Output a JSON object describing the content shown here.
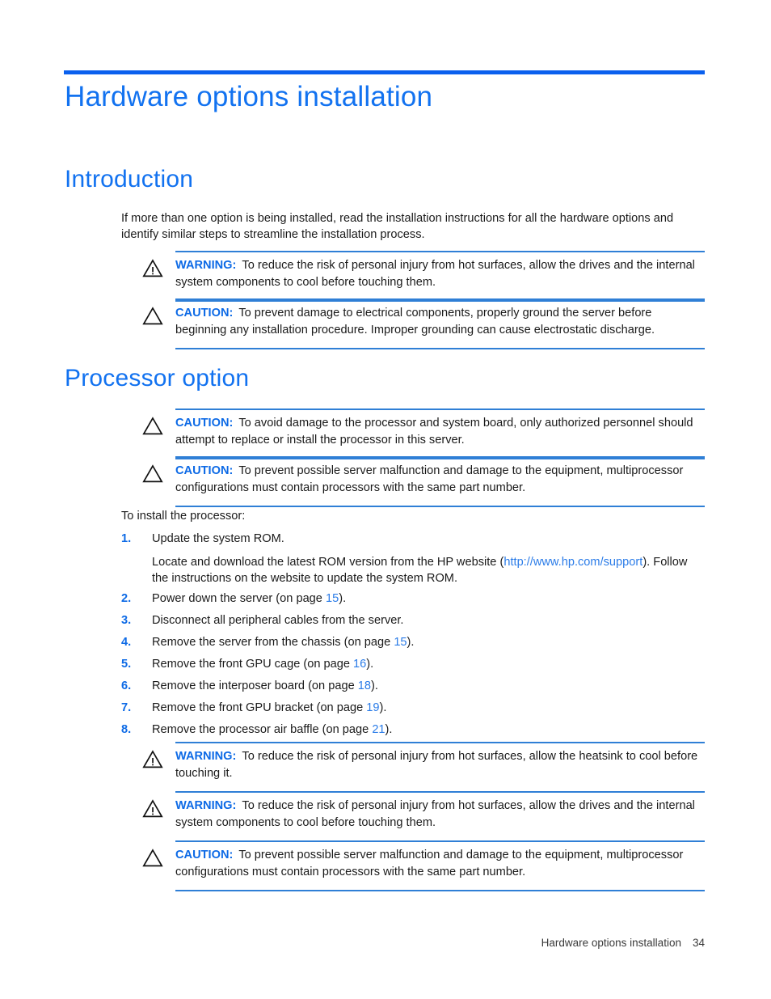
{
  "document": {
    "title": "Hardware options installation",
    "accent_blue": "#1272f0",
    "rule_blue": "#0a60ee",
    "label_blue": "#0d6ae6",
    "link_blue": "#2b7ce8"
  },
  "sections": {
    "introduction": {
      "heading": "Introduction",
      "paragraph": "If more than one option is being installed, read the installation instructions for all the hardware options and identify similar steps to streamline the installation process."
    },
    "processor": {
      "heading": "Processor option",
      "lead_in": "To install the processor:"
    }
  },
  "admonitions": {
    "intro_warning": {
      "icon": "warning-triangle-icon",
      "label": "WARNING:",
      "text": "To reduce the risk of personal injury from hot surfaces, allow the drives and the internal system components to cool before touching them."
    },
    "intro_caution": {
      "icon": "caution-triangle-icon",
      "label": "CAUTION:",
      "text": "To prevent damage to electrical components, properly ground the server before beginning any installation procedure. Improper grounding can cause electrostatic discharge."
    },
    "processor_caution_1": {
      "icon": "caution-triangle-icon",
      "label": "CAUTION:",
      "text": "To avoid damage to the processor and system board, only authorized personnel should attempt to replace or install the processor in this server."
    },
    "processor_caution_2": {
      "icon": "caution-triangle-icon",
      "label": "CAUTION:",
      "text": "To prevent possible server malfunction and damage to the equipment, multiprocessor configurations must contain processors with the same part number."
    },
    "heatsink_warning": {
      "icon": "warning-triangle-icon",
      "label": "WARNING:",
      "text": "To reduce the risk of personal injury from hot surfaces, allow the heatsink to cool before touching it."
    },
    "drives_warning": {
      "icon": "warning-triangle-icon",
      "label": "WARNING:",
      "text": "To reduce the risk of personal injury from hot surfaces, allow the drives and the internal system components to cool before touching them."
    },
    "final_caution": {
      "icon": "caution-triangle-icon",
      "label": "CAUTION:",
      "text": "To prevent possible server malfunction and damage to the equipment, multiprocessor configurations must contain processors with the same part number."
    }
  },
  "steps": [
    {
      "number": "1.",
      "text": "Update the system ROM.",
      "sub_before_link": "Locate and download the latest ROM version from the HP website (",
      "link": "http://www.hp.com/support",
      "sub_after_link": "). Follow the instructions on the website to update the system ROM."
    },
    {
      "number": "2.",
      "before": "Power down the server (on page ",
      "page": "15",
      "after": ")."
    },
    {
      "number": "3.",
      "before": "Disconnect all peripheral cables from the server.",
      "page": "",
      "after": ""
    },
    {
      "number": "4.",
      "before": "Remove the server from the chassis (on page ",
      "page": "15",
      "after": ")."
    },
    {
      "number": "5.",
      "before": "Remove the front GPU cage (on page ",
      "page": "16",
      "after": ")."
    },
    {
      "number": "6.",
      "before": "Remove the interposer board (on page ",
      "page": "18",
      "after": ")."
    },
    {
      "number": "7.",
      "before": "Remove the front GPU bracket (on page ",
      "page": "19",
      "after": ")."
    },
    {
      "number": "8.",
      "before": "Remove the processor air baffle (on page ",
      "page": "21",
      "after": ")."
    }
  ],
  "footer": {
    "chapter": "Hardware options installation",
    "page_number": "34"
  }
}
